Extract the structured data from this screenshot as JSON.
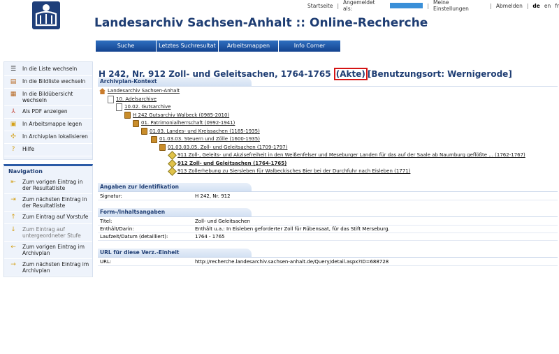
{
  "topbar": {
    "startseite": "Startseite",
    "angemeldet": "Angemeldet als:",
    "einstellungen": "Meine Einstellungen",
    "abmelden": "Abmelden",
    "lang_de": "de",
    "lang_en": "en",
    "lang_fr": "fr"
  },
  "header": {
    "title": "Landesarchiv Sachsen-Anhalt :: Online-Recherche"
  },
  "mainnav": [
    "Suche",
    "Letztes Suchresultat",
    "Arbeitsmappen",
    "Info Corner"
  ],
  "sidebar": {
    "actions": [
      {
        "label": "In die Liste wechseln",
        "icon": "list-icon"
      },
      {
        "label": "In die Bildliste wechseln",
        "icon": "image-list-icon"
      },
      {
        "label": "In die Bildübersicht wechseln",
        "icon": "image-overview-icon"
      },
      {
        "label": "Als PDF anzeigen",
        "icon": "pdf-icon"
      },
      {
        "label": "In Arbeitsmappe legen",
        "icon": "folder-add-icon"
      },
      {
        "label": "In Archivplan lokalisieren",
        "icon": "locate-icon"
      },
      {
        "label": "Hilfe",
        "icon": "help-icon"
      }
    ],
    "nav_header": "Navigation",
    "nav": [
      {
        "label": "Zum vorigen Eintrag in der Resultatliste",
        "icon": "prev-result-icon"
      },
      {
        "label": "Zum nächsten Eintrag in der Resultatliste",
        "icon": "next-result-icon"
      },
      {
        "label": "Zum Eintrag auf Vorstufe",
        "icon": "up-level-icon"
      },
      {
        "label": "Zum Eintrag auf untergeordneter Stufe",
        "icon": "down-level-icon"
      },
      {
        "label": "Zum vorigen Eintrag im Archivplan",
        "icon": "prev-plan-icon"
      },
      {
        "label": "Zum nächsten Eintrag im Archivplan",
        "icon": "next-plan-icon"
      }
    ]
  },
  "record": {
    "title_main": "H 242, Nr. 912 Zoll- und Geleitsachen, 1764-1765",
    "title_type": "(Akte)",
    "title_location": "[Benutzungsort: Wernigerode]"
  },
  "archivplan": {
    "header": "Archivplan-Kontext",
    "tree": [
      {
        "label": "Landesarchiv Sachsen-Anhalt",
        "indent": 0,
        "icon": "house"
      },
      {
        "label": "10. Adelsarchive",
        "indent": 1,
        "icon": "doc"
      },
      {
        "label": "10.02. Gutsarchive",
        "indent": 2,
        "icon": "doc"
      },
      {
        "label": "H 242 Gutsarchiv Walbeck (0985-2010)",
        "indent": 3,
        "icon": "folder"
      },
      {
        "label": "01. Patrimonialherrschaft (0992-1941)",
        "indent": 4,
        "icon": "folder"
      },
      {
        "label": "01.03. Landes- und Kreissachen (1185-1935)",
        "indent": 5,
        "icon": "folder"
      },
      {
        "label": "01.03.03. Steuern und Zölle (1600-1935)",
        "indent": 6,
        "icon": "folder"
      },
      {
        "label": "01.03.03.05. Zoll- und Geleitsachen (1709-1797)",
        "indent": 7,
        "icon": "folder"
      },
      {
        "label": "911 Zoll-, Geleits- und Akzisefreiheit in den Weißenfelser und Meseburger Landen für das auf der Saale ab Naumburg geflößte ... (1762-1767)",
        "indent": 8,
        "icon": "diamond"
      },
      {
        "label": "912 Zoll- und Geleitsachen (1764-1765)",
        "indent": 8,
        "icon": "diamond",
        "current": true
      },
      {
        "label": "913 Zollerhebung zu Siersleben für Walbeckisches Bier bei der Durchfuhr nach Eisleben (1771)",
        "indent": 8,
        "icon": "diamond"
      }
    ]
  },
  "identifikation": {
    "header": "Angaben zur Identifikation",
    "rows": [
      {
        "k": "Signatur:",
        "v": "H 242, Nr. 912"
      }
    ]
  },
  "inhalt": {
    "header": "Form-/Inhaltsangaben",
    "rows": [
      {
        "k": "Titel:",
        "v": "Zoll- und Geleitsachen"
      },
      {
        "k": "Enthält/Darin:",
        "v": "Enthält u.a.: In Eisleben geforderter Zoll für Rübensaat, für das Stift Merseburg."
      },
      {
        "k": "Laufzeit/Datum (detailliert):",
        "v": "1764 - 1765"
      }
    ]
  },
  "url": {
    "header": "URL für diese Verz.-Einheit",
    "rows": [
      {
        "k": "URL:",
        "v": "http://recherche.landesarchiv.sachsen-anhalt.de/Query/detail.aspx?ID=688728"
      }
    ]
  },
  "colors": {
    "brand": "#1e3d73",
    "nav": "#13428e",
    "highlight": "#d41414"
  }
}
